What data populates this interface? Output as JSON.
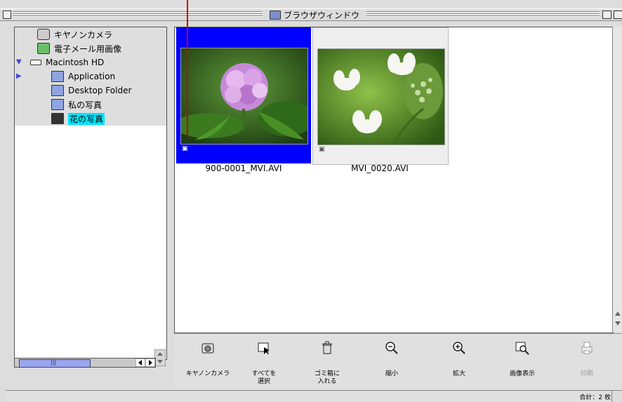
{
  "window": {
    "title": "ブラウザウィンドウ"
  },
  "tree": {
    "items": [
      {
        "label": "キヤノンカメラ",
        "icon": "camera-icon"
      },
      {
        "label": "電子メール用画像",
        "icon": "email-image-icon"
      },
      {
        "label": "Macintosh HD",
        "icon": "hard-disk-icon",
        "expanded": true
      },
      {
        "label": "Application",
        "icon": "folder-icon",
        "collapsed": true
      },
      {
        "label": "Desktop Folder",
        "icon": "folder-icon"
      },
      {
        "label": "私の写真",
        "icon": "folder-icon"
      },
      {
        "label": "花の写真",
        "icon": "folder-open-icon",
        "selected": true
      }
    ]
  },
  "thumbnails": [
    {
      "filename": "900-0001_MVI.AVI",
      "type_icon": "movie-icon",
      "selected": true
    },
    {
      "filename": "MVI_0020.AVI",
      "type_icon": "movie-icon",
      "selected": false
    }
  ],
  "toolbar": {
    "camera_label": "キヤノンカメラ",
    "select_all_label_1": "すべてを",
    "select_all_label_2": "選択",
    "trash_label_1": "ゴミ箱に",
    "trash_label_2": "入れる",
    "shrink_label": "縮小",
    "enlarge_label": "拡大",
    "view_label": "画像表示",
    "print_label": "印刷"
  },
  "status": {
    "total": "合計：2 枚"
  },
  "colors": {
    "selection_blue": "#0000ff",
    "tree_highlight": "#00e5ff",
    "callout_red": "#c40000"
  }
}
